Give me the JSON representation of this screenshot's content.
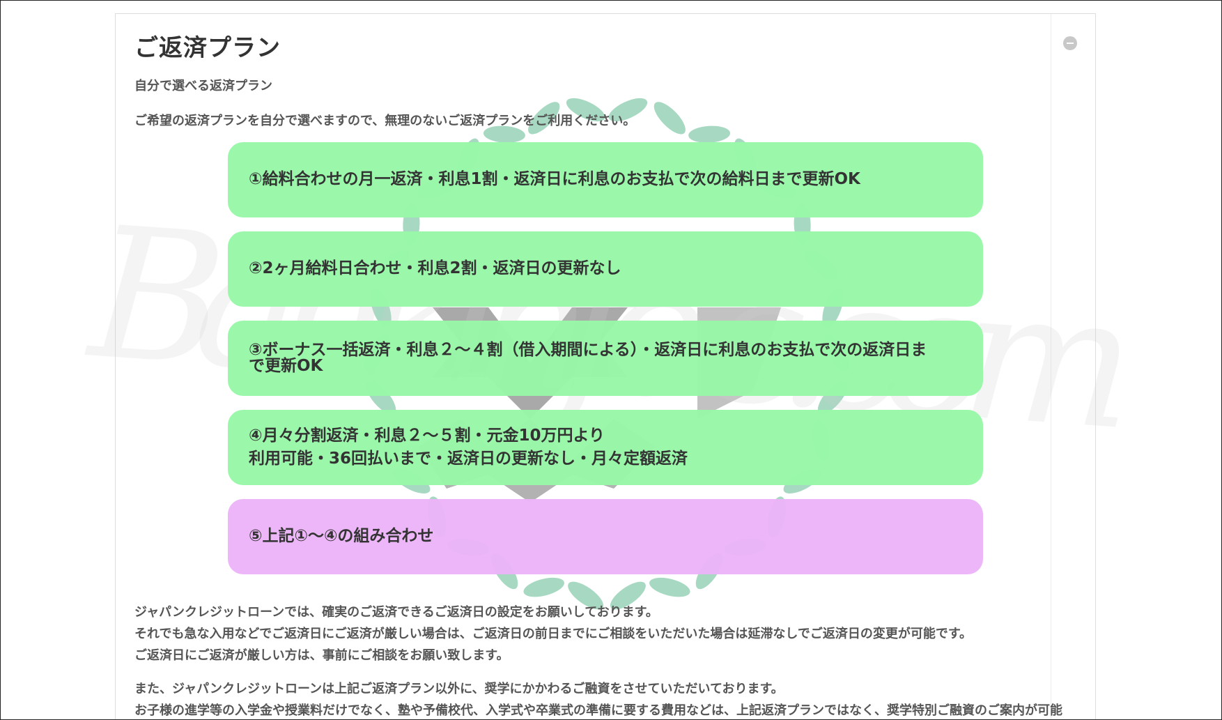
{
  "section": {
    "title": "ご返済プラン",
    "subtitle": "自分で選べる返済プラン",
    "intro": "ご希望の返済プランを自分で選べますので、無理のないご返済プランをご利用ください。"
  },
  "plans": [
    {
      "line1": "①給料合わせの月一返済・利息1割・返済日に利息のお支払で次の給料日まで更新OK",
      "line2": ""
    },
    {
      "line1": "②2ヶ月給料日合わせ・利息2割・返済日の更新なし",
      "line2": ""
    },
    {
      "line1": "③ボーナス一括返済・利息２～４割（借入期間による）・返済日に利息のお支払で次の返済日ま",
      "line2": "で更新OK"
    },
    {
      "line1": "④月々分割返済・利息２～５割・元金10万円より",
      "line2": "利用可能・36回払いまで・返済日の更新なし・月々定額返済"
    },
    {
      "line1": "⑤上記①～④の組み合わせ",
      "line2": ""
    }
  ],
  "notes": {
    "p1_line1": "ジャパンクレジットローンでは、確実のご返済できるご返済日の設定をお願いしております。",
    "p1_line2": "それでも急な入用などでご返済日にご返済が厳しい場合は、ご返済日の前日までにご相談をいただいた場合は延滞なしでご返済日の変更が可能です。",
    "p1_line3": "ご返済日にご返済が厳しい方は、事前にご相談をお願い致します。",
    "p2_line1": "また、ジャパンクレジットローンは上記ご返済プラン以外に、奨学にかかわるご融資をさせていただいております。",
    "p2_line2": "お子様の進学等の入学金や授業料だけでなく、塾や予備校代、入学式や卒業式の準備に要する費用などは、上記返済プランではなく、奨学特別ご融資のご案内が可能"
  },
  "watermark": {
    "text": "Bankinfo-s.com",
    "leaf_color": "#5fb990",
    "emblem_color": "#9a9a9a"
  },
  "colors": {
    "plan_green": "#98f8a8",
    "plan_purple": "#ecb4f8",
    "text": "#333333"
  }
}
